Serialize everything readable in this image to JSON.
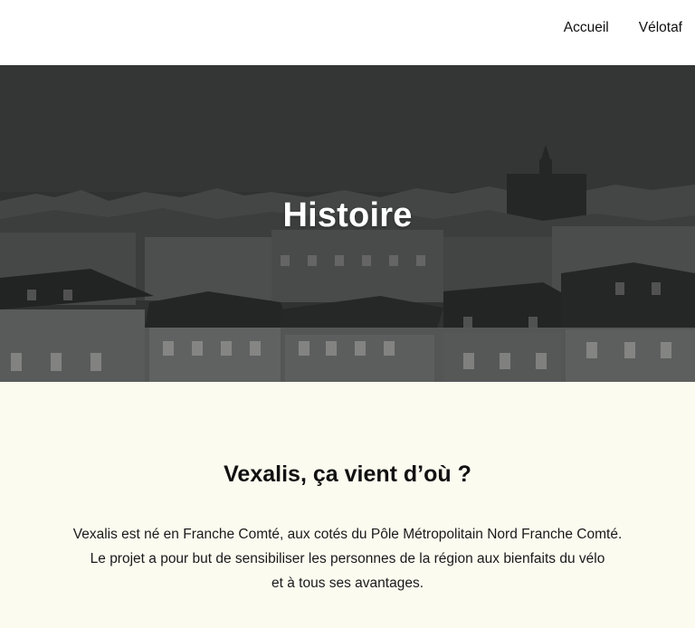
{
  "nav": {
    "items": [
      {
        "label": "Accueil"
      },
      {
        "label": "Vélotaf"
      }
    ]
  },
  "hero": {
    "title": "Histoire"
  },
  "section": {
    "title": "Vexalis, ça vient d’où ?",
    "lines": [
      "Vexalis est né en Franche Comté, aux cotés du Pôle Métropolitain Nord Franche Comté.",
      "Le projet a pour but de sensibiliser les personnes de la région aux bienfaits du vélo",
      "et à tous ses avantages."
    ]
  },
  "colors": {
    "header_bg": "#ffffff",
    "content_bg": "#fbfbf0",
    "hero_text": "#ffffff"
  }
}
